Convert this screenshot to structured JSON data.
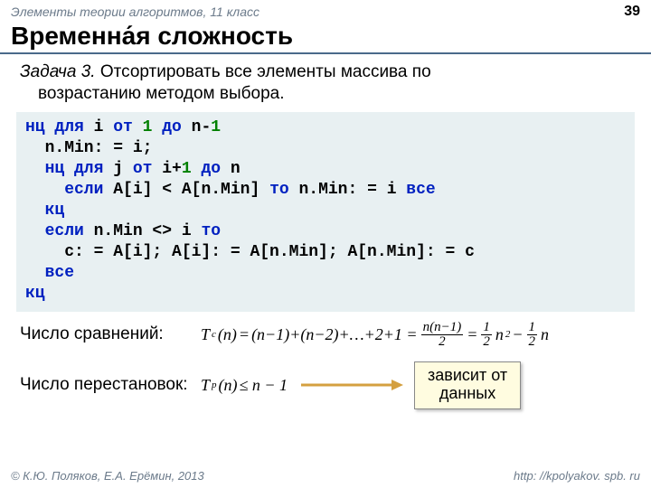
{
  "header": {
    "course": "Элементы теории алгоритмов, 11 класс",
    "page": "39"
  },
  "title": "Временна́я сложность",
  "task": {
    "label": "Задача 3.",
    "line1_rest": " Отсортировать все элементы массива по",
    "line2": "возрастанию методом выбора."
  },
  "code": {
    "l1a": "нц для",
    "l1b": " i ",
    "l1c": "от",
    "l1d": " 1",
    "l1e": " до",
    "l1f": " n-",
    "l1g": "1",
    "l2": "  n.Min: = i;",
    "l3a": "  нц для",
    "l3b": " j ",
    "l3c": "от",
    "l3d": " i+",
    "l3e": "1",
    "l3f": " до",
    "l3g": " n",
    "l4a": "    если",
    "l4b": " A[i] < A[n.Min] ",
    "l4c": "то",
    "l4d": " n.Min: = i ",
    "l4e": "все",
    "l5": "  кц",
    "l6a": "  если",
    "l6b": " n.Min <> i ",
    "l6c": "то",
    "l7": "    c: = A[i]; A[i]: = A[n.Min]; A[n.Min]: = c",
    "l8": "  все",
    "l9": "кц"
  },
  "rows": {
    "compare_label": "Число сравнений:",
    "perm_label": "Число перестановок:",
    "note_l1": "зависит от",
    "note_l2": "данных"
  },
  "formula": {
    "tc": "T",
    "c_sub": "c",
    "n_arg": "(n)",
    "eq": " = ",
    "t1": "(n−1)+(n−2)+…+2+1 = ",
    "f1top": "n(n−1)",
    "f1bot": "2",
    "eq2": " = ",
    "half": "1",
    "two": "2",
    "n2": " n",
    "sq": "2",
    "minus": " − ",
    "n_last": " n",
    "tp": "T",
    "p_sub": "p",
    "le": " ≤ n − 1"
  },
  "footer": {
    "left": "© К.Ю. Поляков, Е.А. Ерёмин, 2013",
    "right": "http: //kpolyakov. spb. ru"
  }
}
